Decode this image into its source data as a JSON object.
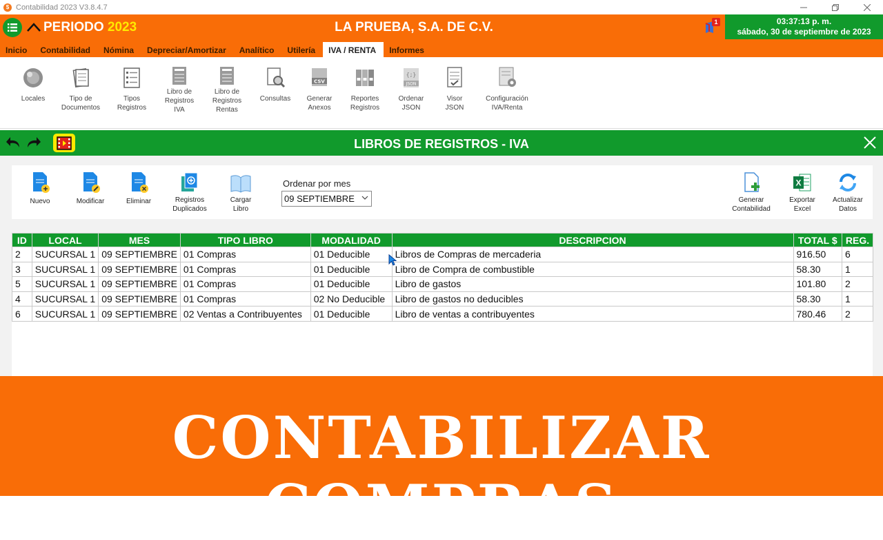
{
  "window": {
    "title": "Contabilidad 2023 V3.8.4.7",
    "app_icon": "$"
  },
  "header": {
    "periodo_label": "PERIODO",
    "periodo_year": "2023",
    "company": "LA PRUEBA, S.A. DE C.V.",
    "notif_count": "1",
    "time": "03:37:13 p. m.",
    "date": "sábado, 30 de septiembre de 2023"
  },
  "tabs": [
    {
      "label": "Inicio"
    },
    {
      "label": "Contabilidad"
    },
    {
      "label": "Nómina"
    },
    {
      "label": "Depreciar/Amortizar"
    },
    {
      "label": "Analítico"
    },
    {
      "label": "Utilería"
    },
    {
      "label": "IVA / RENTA"
    },
    {
      "label": "Informes"
    }
  ],
  "ribbon": [
    {
      "label": "Locales",
      "icon": "locales-icon"
    },
    {
      "label": "Tipo de\nDocumentos",
      "icon": "documents-icon"
    },
    {
      "label": "Tipos\nRegistros",
      "icon": "registros-icon"
    },
    {
      "label": "Libro de\nRegistros\nIVA",
      "icon": "book-iva-icon"
    },
    {
      "label": "Libro de\nRegistros\nRentas",
      "icon": "book-rentas-icon"
    },
    {
      "label": "Consultas",
      "icon": "search-doc-icon"
    },
    {
      "label": "Generar\nAnexos",
      "icon": "csv-icon"
    },
    {
      "label": "Reportes\nRegistros",
      "icon": "binders-icon"
    },
    {
      "label": "Ordenar\nJSON",
      "icon": "json-icon"
    },
    {
      "label": "Visor\nJSON",
      "icon": "viewer-icon"
    },
    {
      "label": "Configuración\nIVA/Renta",
      "icon": "config-icon"
    }
  ],
  "section": {
    "title": "LIBROS DE REGISTROS - IVA"
  },
  "toolbar": {
    "nuevo": "Nuevo",
    "modificar": "Modificar",
    "eliminar": "Eliminar",
    "duplicados": "Registros\nDuplicados",
    "cargar": "Cargar\nLibro",
    "generar": "Generar\nContabilidad",
    "exportar": "Exportar\nExcel",
    "actualizar": "Actualizar\nDatos"
  },
  "order": {
    "label": "Ordenar por mes",
    "selected": "09 SEPTIEMBRE"
  },
  "table": {
    "headers": [
      "ID",
      "LOCAL",
      "MES",
      "TIPO LIBRO",
      "MODALIDAD",
      "DESCRIPCION",
      "TOTAL $",
      "REG."
    ],
    "rows": [
      [
        "2",
        "SUCURSAL 1",
        "09 SEPTIEMBRE",
        "01 Compras",
        "01 Deducible",
        "Libros de Compras de mercaderia",
        "916.50",
        "6"
      ],
      [
        "3",
        "SUCURSAL 1",
        "09 SEPTIEMBRE",
        "01 Compras",
        "01 Deducible",
        "Libro de Compra de combustible",
        "58.30",
        "1"
      ],
      [
        "5",
        "SUCURSAL 1",
        "09 SEPTIEMBRE",
        "01 Compras",
        "01 Deducible",
        "Libro de gastos",
        "101.80",
        "2"
      ],
      [
        "4",
        "SUCURSAL 1",
        "09 SEPTIEMBRE",
        "01 Compras",
        "02 No Deducible",
        "Libro de gastos no deducibles",
        "58.30",
        "1"
      ],
      [
        "6",
        "SUCURSAL 1",
        "09 SEPTIEMBRE",
        "02 Ventas a Contribuyentes",
        "01 Deducible",
        "Libro de ventas a contribuyentes",
        "780.46",
        "2"
      ]
    ]
  },
  "banner": {
    "text": "CONTABILIZAR COMPRAS"
  },
  "colors": {
    "orange": "#f96d07",
    "green": "#119a2c",
    "yellow": "#ffe900"
  }
}
